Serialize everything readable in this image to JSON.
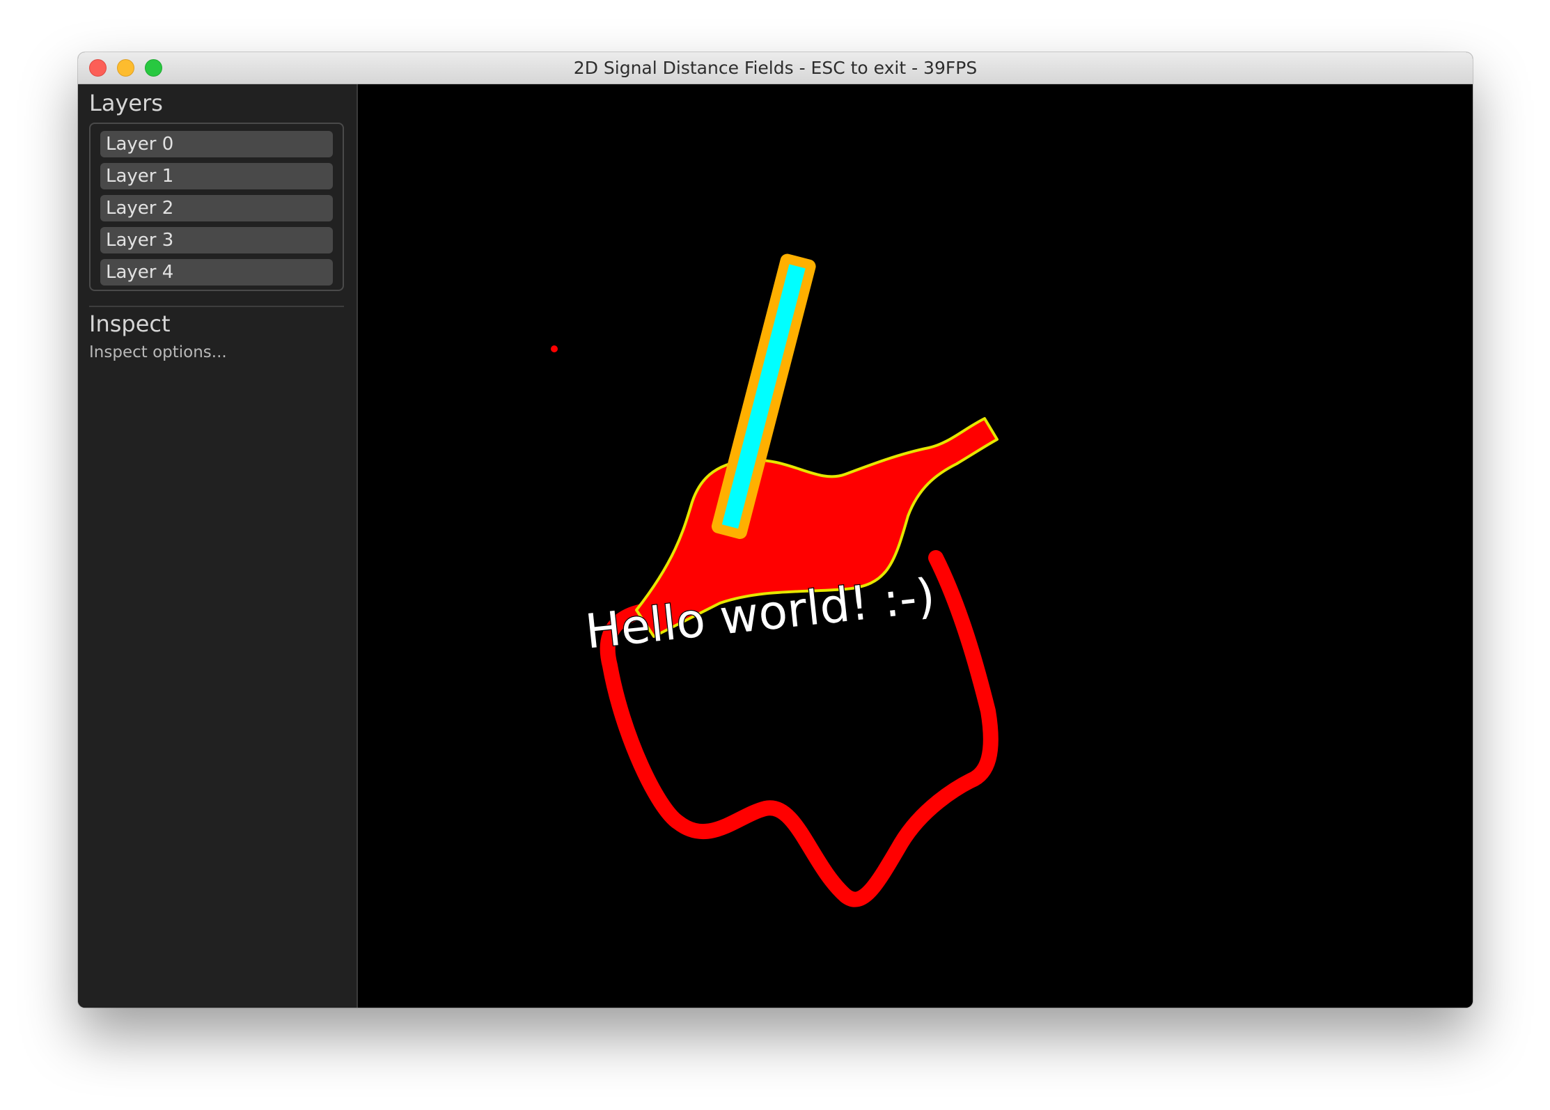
{
  "window": {
    "title": "2D Signal Distance Fields - ESC to exit - 39FPS"
  },
  "sidebar": {
    "layers_title": "Layers",
    "layers": [
      {
        "label": "Layer 0"
      },
      {
        "label": "Layer 1"
      },
      {
        "label": "Layer 2"
      },
      {
        "label": "Layer 3"
      },
      {
        "label": "Layer 4"
      }
    ],
    "inspect_title": "Inspect",
    "inspect_subtitle": "Inspect options..."
  },
  "canvas": {
    "text": "Hello world! :-)",
    "colors": {
      "background": "#000000",
      "blob": "#ff0000",
      "bottle_outline": "#e6e600",
      "bar_fill": "#00ffff",
      "bar_outline": "#ffb000",
      "text": "#ffffff",
      "dot": "#ff0000"
    }
  }
}
